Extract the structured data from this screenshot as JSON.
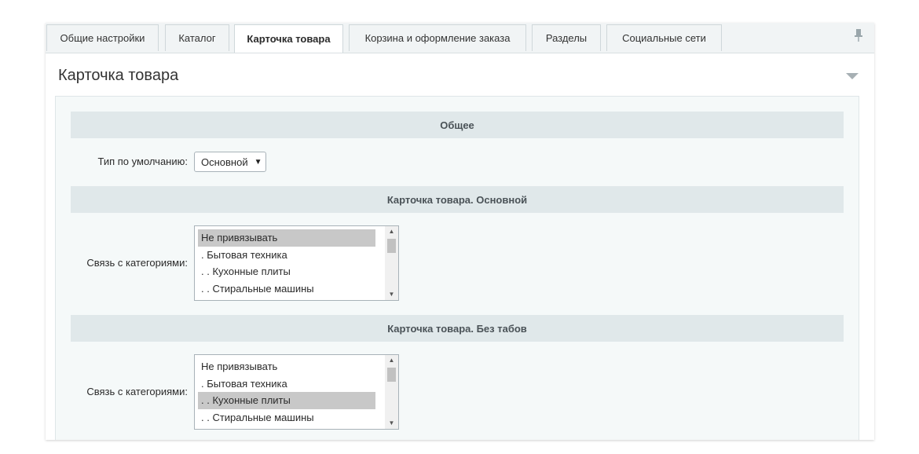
{
  "tabs": [
    {
      "label": "Общие настройки",
      "active": false
    },
    {
      "label": "Каталог",
      "active": false
    },
    {
      "label": "Карточка товара",
      "active": true
    },
    {
      "label": "Корзина и оформление заказа",
      "active": false
    },
    {
      "label": "Разделы",
      "active": false
    },
    {
      "label": "Социальные сети",
      "active": false
    }
  ],
  "section": {
    "title": "Карточка товара"
  },
  "general": {
    "heading": "Общее",
    "default_type_label": "Тип по умолчанию:",
    "default_type_value": "Основной"
  },
  "card_main": {
    "heading": "Карточка товара. Основной",
    "link_label": "Связь с категориями:",
    "options": [
      "Не привязывать",
      ". Бытовая техника",
      ". . Кухонные плиты",
      ". . Стиральные машины"
    ],
    "selected_index": 0
  },
  "card_notabs": {
    "heading": "Карточка товара. Без табов",
    "link_label": "Связь с категориями:",
    "options": [
      "Не привязывать",
      ". Бытовая техника",
      ". . Кухонные плиты",
      ". . Стиральные машины"
    ],
    "selected_index": 2
  },
  "icons": {
    "pin": "pin-icon",
    "collapse": "collapse-arrow-icon",
    "caret": "caret-down-icon"
  }
}
